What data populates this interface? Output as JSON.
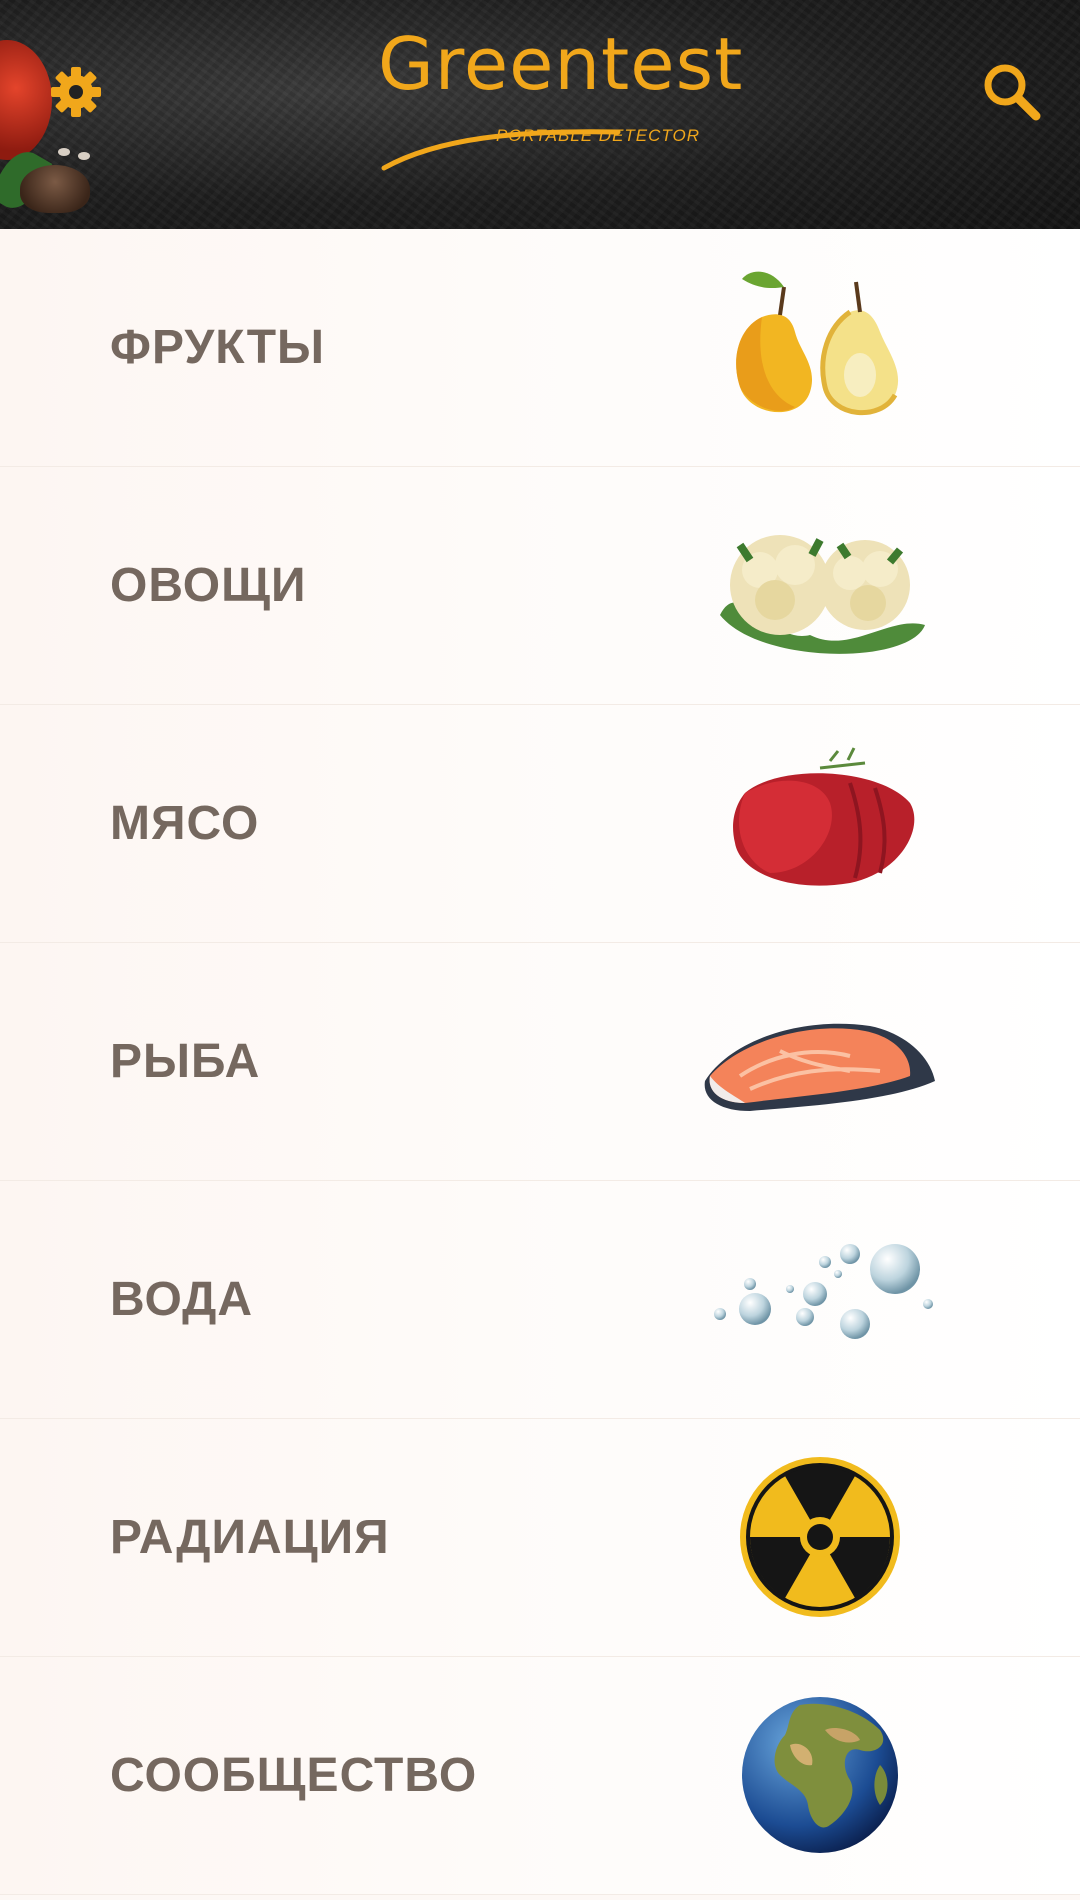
{
  "header": {
    "logo_title": "Greentest",
    "logo_subtitle": "PORTABLE DETECTOR",
    "settings_icon": "gear-icon",
    "search_icon": "search-icon",
    "accent": "#f1a71b"
  },
  "categories": [
    {
      "label": "ФРУКТЫ",
      "image": "pears"
    },
    {
      "label": "ОВОЩИ",
      "image": "cauliflower"
    },
    {
      "label": "МЯСО",
      "image": "meat"
    },
    {
      "label": "РЫБА",
      "image": "salmon"
    },
    {
      "label": "ВОДА",
      "image": "water-drops"
    },
    {
      "label": "РАДИАЦИЯ",
      "image": "radiation-symbol"
    },
    {
      "label": "СООБЩЕСТВО",
      "image": "earth-globe"
    }
  ],
  "colors": {
    "label_text": "#75685f",
    "header_bg": "#1e1e1e"
  }
}
